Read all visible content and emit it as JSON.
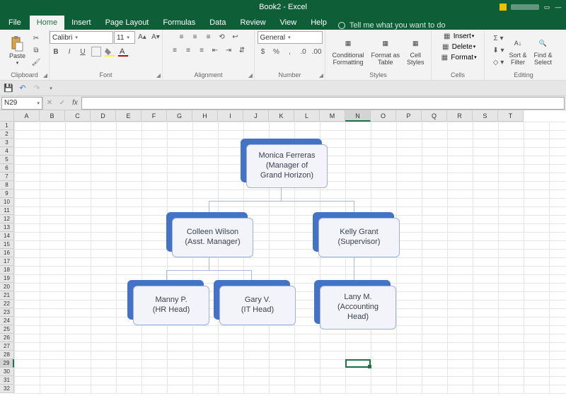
{
  "title": "Book2 - Excel",
  "tabs": {
    "file": "File",
    "home": "Home",
    "insert": "Insert",
    "page": "Page Layout",
    "formulas": "Formulas",
    "data": "Data",
    "review": "Review",
    "view": "View",
    "help": "Help",
    "tell": "Tell me what you want to do"
  },
  "ribbon": {
    "clipboard": {
      "paste": "Paste",
      "label": "Clipboard"
    },
    "font": {
      "name": "Calibri",
      "size": "11",
      "label": "Font"
    },
    "alignment": {
      "label": "Alignment"
    },
    "number": {
      "format": "General",
      "label": "Number"
    },
    "styles": {
      "cf": "Conditional\nFormatting",
      "fat": "Format as\nTable",
      "cs": "Cell\nStyles",
      "label": "Styles"
    },
    "cells": {
      "insert": "Insert",
      "delete": "Delete",
      "format": "Format",
      "label": "Cells"
    },
    "editing": {
      "sort": "Sort &\nFilter",
      "find": "Find &\nSelect",
      "label": "Editing"
    }
  },
  "namebox": "N29",
  "columns": [
    "A",
    "B",
    "C",
    "D",
    "E",
    "F",
    "G",
    "H",
    "I",
    "J",
    "K",
    "L",
    "M",
    "N",
    "O",
    "P",
    "Q",
    "R",
    "S",
    "T"
  ],
  "rows": [
    "1",
    "2",
    "3",
    "4",
    "5",
    "6",
    "7",
    "8",
    "9",
    "10",
    "11",
    "12",
    "13",
    "14",
    "15",
    "16",
    "17",
    "18",
    "19",
    "20",
    "21",
    "22",
    "23",
    "24",
    "25",
    "26",
    "27",
    "28",
    "29",
    "30",
    "31",
    "32"
  ],
  "active": {
    "col": "N",
    "row": "29"
  },
  "org": {
    "top_name": "Monica Ferreras",
    "top_title": "(Manager of\nGrand Horizon)",
    "m1_name": "Colleen Wilson",
    "m1_title": "(Asst. Manager)",
    "m2_name": "Kelly Grant",
    "m2_title": "(Supervisor)",
    "b1_name": "Manny P.",
    "b1_title": "(HR Head)",
    "b2_name": "Gary V.",
    "b2_title": "(IT Head)",
    "b3_name": "Lany M.",
    "b3_title": "(Accounting\nHead)"
  }
}
